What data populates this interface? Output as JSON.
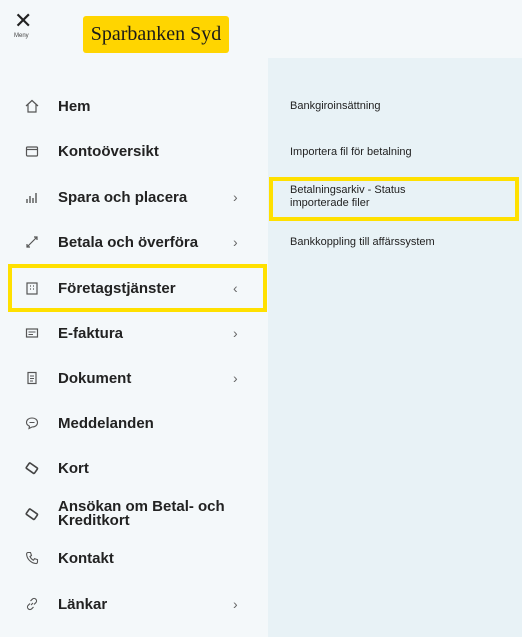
{
  "header": {
    "menu_label": "Meny",
    "logo_text": "Sparbanken Syd"
  },
  "nav": {
    "items": [
      {
        "label": "Hem",
        "icon": "home-icon"
      },
      {
        "label": "Kontoöversikt",
        "icon": "wallet-icon"
      },
      {
        "label": "Spara och placera",
        "icon": "chart-icon",
        "chevron": "›"
      },
      {
        "label": "Betala och överföra",
        "icon": "transfer-icon",
        "chevron": "›"
      },
      {
        "label": "Företagstjänster",
        "icon": "building-icon",
        "chevron": "‹"
      },
      {
        "label": "E-faktura",
        "icon": "invoice-icon",
        "chevron": "›"
      },
      {
        "label": "Dokument",
        "icon": "document-icon",
        "chevron": "›"
      },
      {
        "label": "Meddelanden",
        "icon": "message-icon"
      },
      {
        "label": "Kort",
        "icon": "card-icon"
      },
      {
        "label": "Ansökan om Betal- och Kreditkort",
        "icon": "card-icon"
      },
      {
        "label": "Kontakt",
        "icon": "phone-icon"
      },
      {
        "label": "Länkar",
        "icon": "link-icon",
        "chevron": "›"
      }
    ]
  },
  "submenu": {
    "items": [
      {
        "label": "Bankgiroinsättning"
      },
      {
        "label": "Importera fil för betalning"
      },
      {
        "label_line1": "Betalningsarkiv - Status",
        "label_line2": "importerade filer"
      },
      {
        "label": "Bankkoppling till affärssystem"
      }
    ]
  },
  "colors": {
    "accent": "#ffd500",
    "highlight": "#ffe000"
  }
}
